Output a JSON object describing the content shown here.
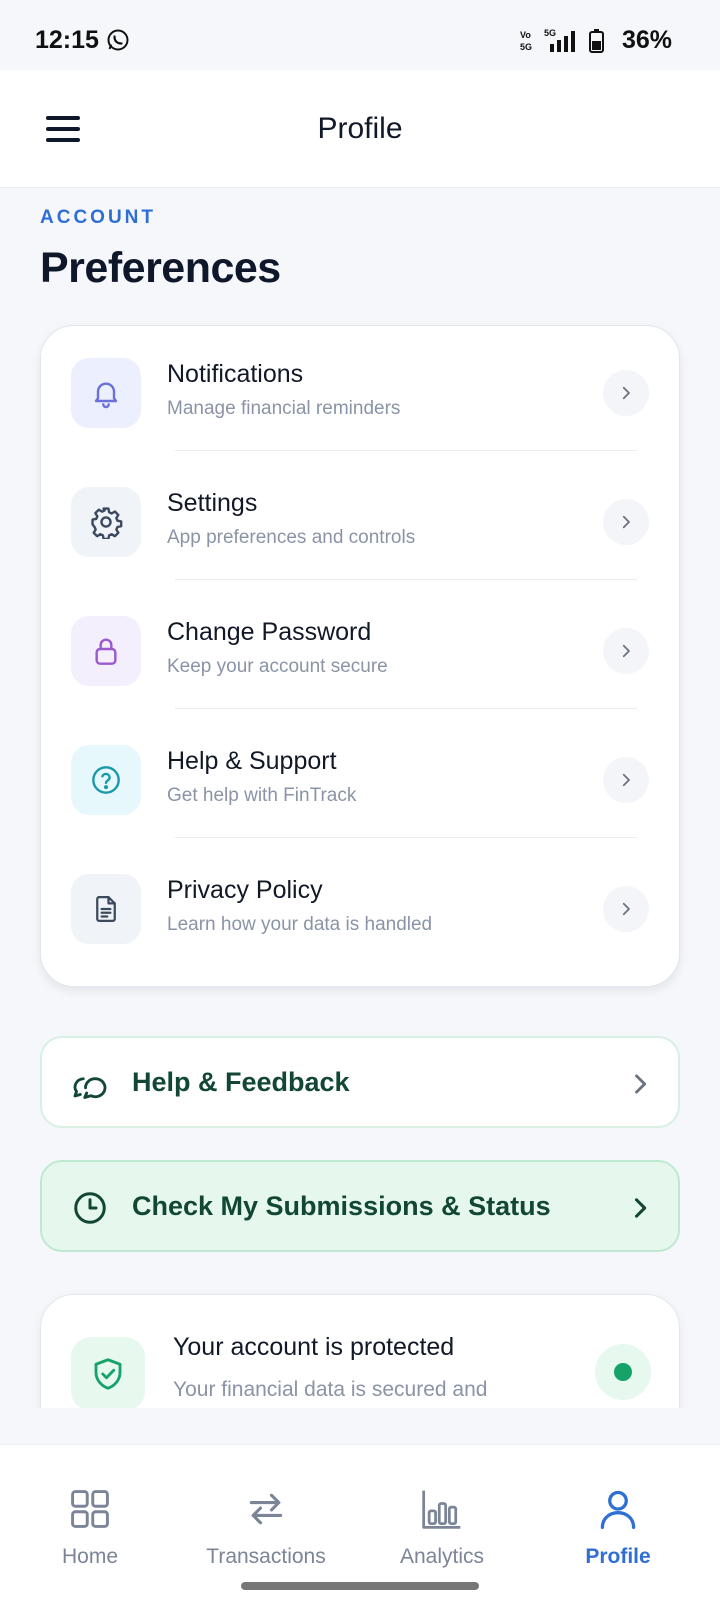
{
  "status_bar": {
    "time": "12:15",
    "network": "Vo 5G",
    "signal": "5G",
    "battery": "36%"
  },
  "app_bar": {
    "title": "Profile",
    "menu_icon": "hamburger-menu-icon"
  },
  "section": {
    "label": "ACCOUNT",
    "title": "Preferences"
  },
  "preferences": [
    {
      "title": "Notifications",
      "subtitle": "Manage financial reminders",
      "icon": "bell-icon",
      "icon_color": "#6b6fd8",
      "icon_bg": "#eceffd"
    },
    {
      "title": "Settings",
      "subtitle": "App preferences and controls",
      "icon": "gear-icon",
      "icon_color": "#3b4a5e",
      "icon_bg": "#f0f3f7"
    },
    {
      "title": "Change Password",
      "subtitle": "Keep your account secure",
      "icon": "lock-icon",
      "icon_color": "#9b59d0",
      "icon_bg": "#f4effd"
    },
    {
      "title": "Help & Support",
      "subtitle": "Get help with FinTrack",
      "icon": "help-circle-icon",
      "icon_color": "#1a9aa8",
      "icon_bg": "#e6f8fb"
    },
    {
      "title": "Privacy Policy",
      "subtitle": "Learn how your data is handled",
      "icon": "document-icon",
      "icon_color": "#3b4a5e",
      "icon_bg": "#f0f3f7"
    }
  ],
  "actions": {
    "help_feedback": {
      "label": "Help & Feedback",
      "icon": "chat-bubbles-icon"
    },
    "submissions": {
      "label": "Check My Submissions & Status",
      "icon": "clock-icon"
    }
  },
  "protection": {
    "title": "Your account is protected",
    "subtitle": "Your financial data is secured and accessible only to you",
    "icon": "shield-check-icon",
    "status_color": "#16a36a"
  },
  "bottom_nav": [
    {
      "label": "Home",
      "icon": "grid-icon",
      "active": false
    },
    {
      "label": "Transactions",
      "icon": "swap-arrows-icon",
      "active": false
    },
    {
      "label": "Analytics",
      "icon": "bar-chart-icon",
      "active": false
    },
    {
      "label": "Profile",
      "icon": "user-icon",
      "active": true
    }
  ],
  "colors": {
    "accent": "#2f6fd4",
    "green_text": "#124734",
    "background": "#f5f7fa"
  }
}
